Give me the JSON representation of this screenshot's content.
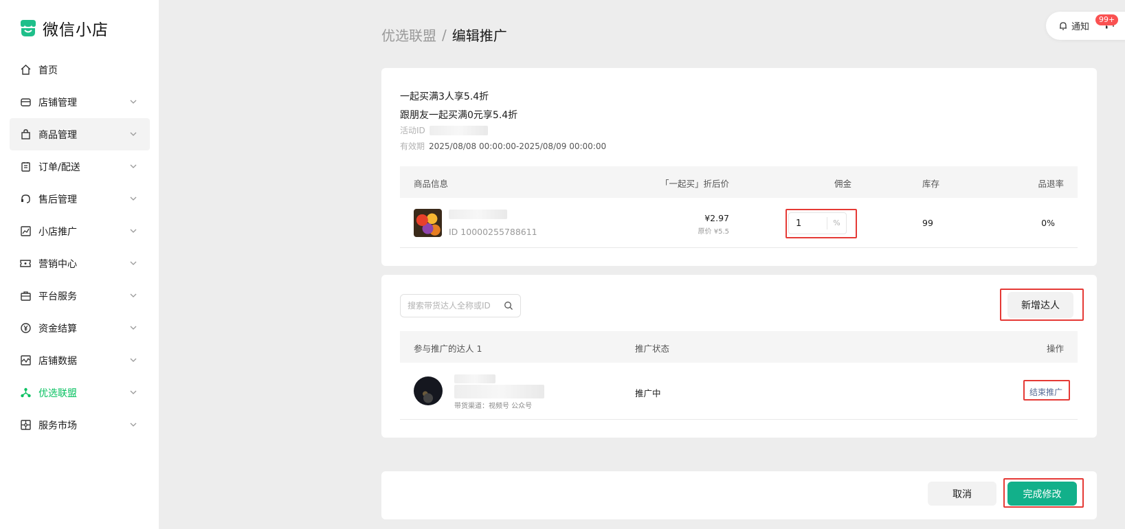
{
  "app": {
    "title": "微信小店"
  },
  "sidebar": {
    "items": [
      {
        "label": "首页",
        "icon": "home-icon"
      },
      {
        "label": "店铺管理",
        "icon": "store-icon"
      },
      {
        "label": "商品管理",
        "icon": "shopping-bag-icon"
      },
      {
        "label": "订单/配送",
        "icon": "clipboard-icon"
      },
      {
        "label": "售后管理",
        "icon": "headset-icon"
      },
      {
        "label": "小店推广",
        "icon": "trend-chart-icon"
      },
      {
        "label": "营销中心",
        "icon": "ticket-icon"
      },
      {
        "label": "平台服务",
        "icon": "briefcase-icon"
      },
      {
        "label": "资金结算",
        "icon": "yuan-circle-icon"
      },
      {
        "label": "店铺数据",
        "icon": "line-chart-icon"
      },
      {
        "label": "优选联盟",
        "icon": "network-icon"
      },
      {
        "label": "服务市场",
        "icon": "puzzle-icon"
      }
    ],
    "highlighted_index": 2,
    "active_index": 10,
    "accent_color": "#07c160"
  },
  "topbar": {
    "notification_label": "通知",
    "notification_badge": "99+"
  },
  "breadcrumb": {
    "parent": "优选联盟",
    "separator": "/",
    "current": "编辑推广"
  },
  "activity": {
    "title1": "一起买满3人享5.4折",
    "title2": "跟朋友一起买满0元享5.4折",
    "id_label": "活动ID",
    "validity_label": "有效期",
    "validity_value": "2025/08/08 00:00:00-2025/08/09 00:00:00"
  },
  "product_table": {
    "headers": {
      "info": "商品信息",
      "price": "「一起买」折后价",
      "commission": "佣金",
      "stock": "库存",
      "refund": "品退率"
    },
    "row": {
      "id": "ID 10000255788611",
      "price": "¥2.97",
      "original_price": "原价 ¥5.5",
      "commission_value": "1",
      "commission_unit": "%",
      "stock": "99",
      "refund_rate": "0%"
    }
  },
  "influencer": {
    "search_placeholder": "搜索带货达人全称或ID",
    "add_button": "新增达人",
    "headers": {
      "participants": "参与推广的达人 1",
      "status": "推广状态",
      "ops": "操作"
    },
    "row": {
      "channels": "带货渠道：视频号 公众号",
      "status": "推广中",
      "action": "结束推广"
    }
  },
  "footer": {
    "cancel": "取消",
    "confirm": "完成修改"
  },
  "colors": {
    "primary": "#12b08a",
    "highlight_border": "#e53935",
    "link": "#576b95",
    "badge": "#fa5151"
  }
}
